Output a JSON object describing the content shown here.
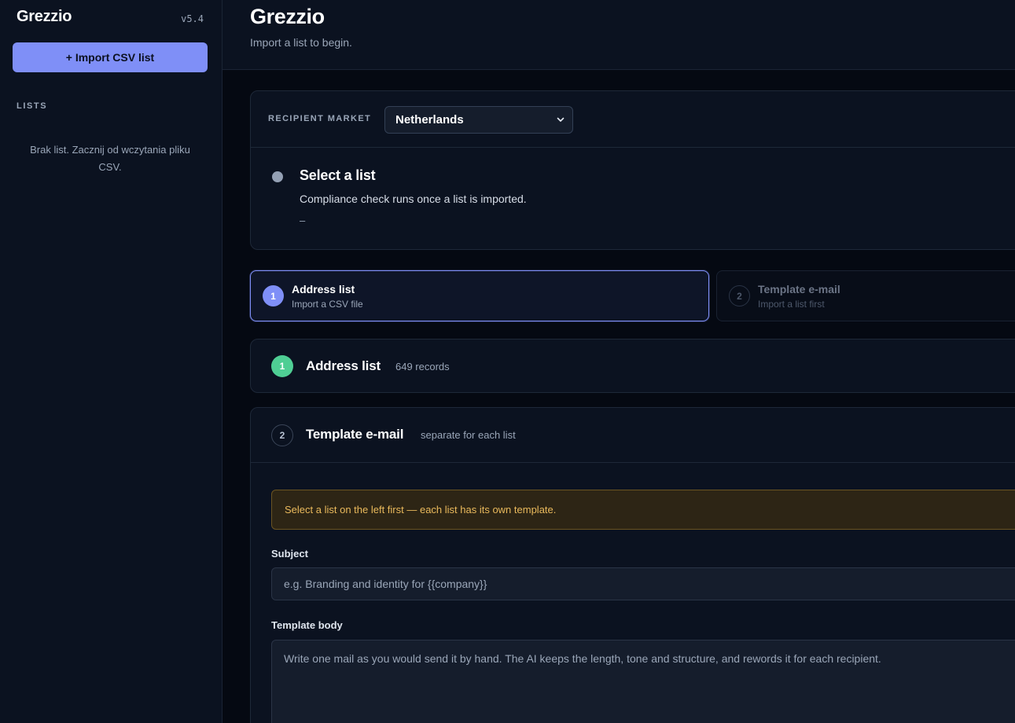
{
  "sidebar": {
    "brand": "Grezzio",
    "version": "v5.4",
    "import_button": "+ Import CSV list",
    "section_title": "LISTS",
    "empty_text": "Brak list. Zacznij od wczytania pliku CSV."
  },
  "header": {
    "title": "Grezzio",
    "subtitle": "Import a list to begin."
  },
  "market": {
    "label": "RECIPIENT MARKET",
    "selected": "Netherlands",
    "chevron_icon": "chevron-down-icon"
  },
  "status": {
    "title": "Select a list",
    "description": "Compliance check runs once a list is imported.",
    "detail": "–"
  },
  "steps": [
    {
      "number": "1",
      "title": "Address list",
      "subtitle": "Import a CSV file",
      "active": true
    },
    {
      "number": "2",
      "title": "Template e-mail",
      "subtitle": "Import a list first",
      "active": false
    }
  ],
  "address_section": {
    "number": "1",
    "title": "Address list",
    "meta": "649 records",
    "color": "#4fce94"
  },
  "template_section": {
    "number": "2",
    "title": "Template e-mail",
    "meta": "separate for each list",
    "warning": "Select a list on the left first — each list has its own template.",
    "subject_label": "Subject",
    "subject_placeholder": "e.g. Branding and identity for {{company}}",
    "body_label": "Template body",
    "body_placeholder": "Write one mail as you would send it by hand. The AI keeps the length, tone and structure, and rewords it for each recipient."
  },
  "colors": {
    "accent": "#7f8ff7",
    "success": "#4fce94",
    "warning_text": "#e9b95c",
    "background": "#050912",
    "panel": "#0b1220"
  }
}
